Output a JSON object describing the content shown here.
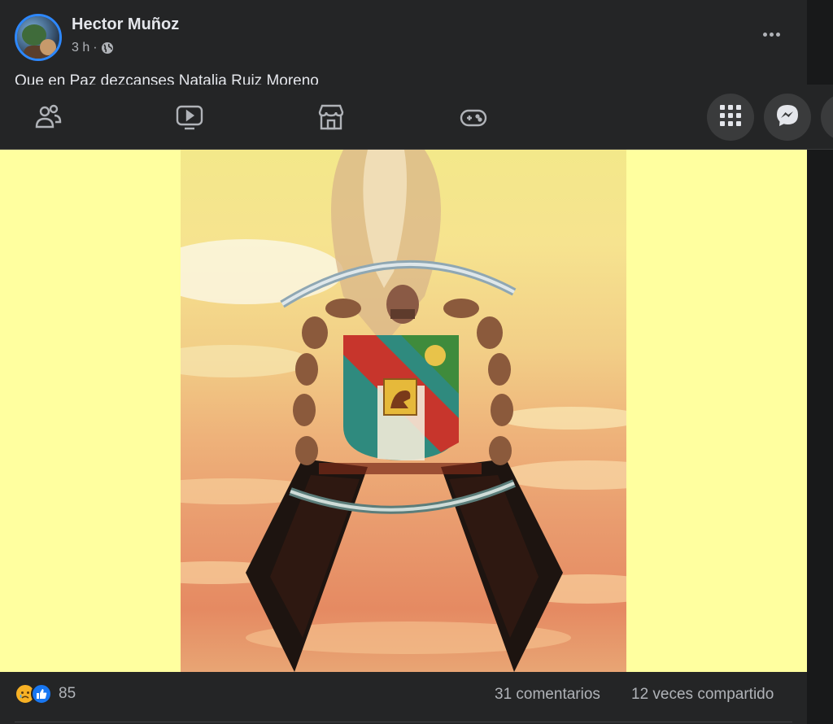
{
  "post": {
    "author": "Hector Muñoz",
    "time": "3 h",
    "separator": "·",
    "caption": "Que en Paz dezcanses Natalia Ruiz Moreno"
  },
  "navbar": {
    "icons": [
      "friends-icon",
      "watch-icon",
      "marketplace-icon",
      "gaming-icon"
    ],
    "buttons": [
      "menu-grid-icon",
      "messenger-icon"
    ]
  },
  "footer": {
    "reaction_icons": [
      "sad-reaction-icon",
      "like-reaction-icon"
    ],
    "reaction_count": "85",
    "comments": "31 comentarios",
    "shares": "12 veces compartido"
  },
  "colors": {
    "background": "#242526",
    "photo_letterbox": "#ffff9f",
    "accent": "#2d88ff",
    "secondary_text": "#b0b3b8"
  }
}
